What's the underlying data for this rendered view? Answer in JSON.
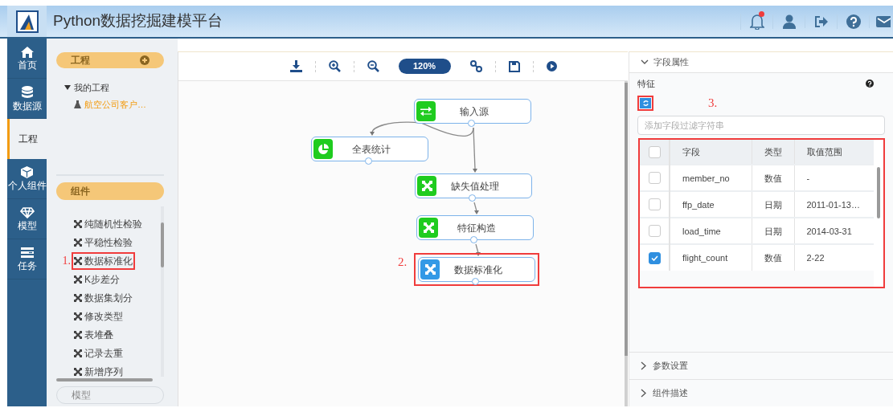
{
  "header": {
    "title": "Python数据挖掘建模平台",
    "notification_dot": true
  },
  "nav": [
    {
      "label": "首页",
      "selected": false
    },
    {
      "label": "数据源",
      "selected": false
    },
    {
      "label": "工程",
      "selected": true
    },
    {
      "label": "个人组件",
      "selected": false
    },
    {
      "label": "模型",
      "selected": false
    },
    {
      "label": "任务",
      "selected": false
    }
  ],
  "project_panel": {
    "title": "工程",
    "tree": [
      {
        "label": "我的工程",
        "expanded": true,
        "children": [
          {
            "label": "航空公司客户…"
          }
        ]
      }
    ]
  },
  "component_panel": {
    "title": "组件",
    "items": [
      {
        "label": "纯随机性检验"
      },
      {
        "label": "平稳性检验"
      },
      {
        "label": "数据标准化",
        "annotation": "1."
      },
      {
        "label": "K步差分"
      },
      {
        "label": "数据集划分"
      },
      {
        "label": "修改类型"
      },
      {
        "label": "表堆叠"
      },
      {
        "label": "记录去重"
      },
      {
        "label": "新增序列"
      }
    ]
  },
  "model_panel": {
    "title": "模型"
  },
  "toolbar": {
    "zoom": "120%"
  },
  "canvas": {
    "nodes": [
      {
        "label": "输入源",
        "kind": "swap",
        "selected": false
      },
      {
        "label": "全表统计",
        "kind": "pie",
        "selected": false
      },
      {
        "label": "缺失值处理",
        "kind": "cross",
        "selected": false
      },
      {
        "label": "特征构造",
        "kind": "cross",
        "selected": false
      },
      {
        "label": "数据标准化",
        "kind": "cross",
        "selected": true,
        "annotation": "2."
      }
    ]
  },
  "field_properties": {
    "title": "字段属性",
    "expanded": true,
    "feature_label": "特征",
    "refresh_annotation": "3.",
    "filter": {
      "placeholder": "添加字段过滤字符串"
    },
    "table": {
      "all_checked": false,
      "columns": [
        "字段",
        "类型",
        "取值范围"
      ],
      "rows": [
        {
          "field": "member_no",
          "type": "数值",
          "range": "-",
          "checked": false
        },
        {
          "field": "ffp_date",
          "type": "日期",
          "range": "2011-01-13…",
          "checked": false
        },
        {
          "field": "load_time",
          "type": "日期",
          "range": "2014-03-31",
          "checked": false
        },
        {
          "field": "flight_count",
          "type": "数值",
          "range": "2-22",
          "checked": true
        }
      ]
    }
  },
  "sections": [
    {
      "title": "参数设置",
      "expanded": false
    },
    {
      "title": "组件描述",
      "expanded": false
    }
  ]
}
